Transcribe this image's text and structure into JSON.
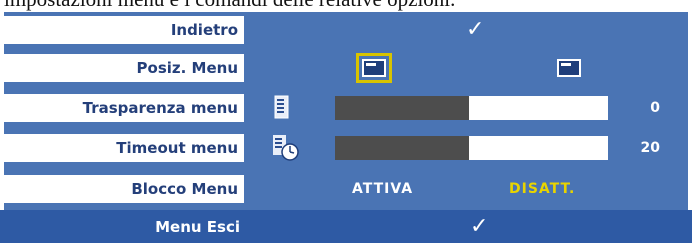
{
  "caption_fragment": "impostazioni menu e i comandi delle relative opzioni.",
  "menu": {
    "back": {
      "label": "Indietro"
    },
    "menu_position": {
      "label": "Posiz. Menu"
    },
    "menu_transparency": {
      "label": "Trasparenza menu",
      "value": "0",
      "level": 0.49
    },
    "menu_timeout": {
      "label": "Timeout menu",
      "value": "20",
      "level": 0.49
    },
    "menu_lock": {
      "label": "Blocco Menu",
      "option_on": "ATTIVA",
      "option_off": "DISATT.",
      "selected": "DISATT."
    },
    "exit": {
      "label": "Menu Esci"
    }
  },
  "check_glyph": "✓",
  "colors": {
    "panel_bg": "#4a74b4",
    "label_text": "#243f7a",
    "exit_bar": "#2e5aa4",
    "selected_option": "#e8d400",
    "selected_outline": "#d8c400",
    "slider_fill": "#4d4d4d"
  },
  "icons": [
    "checkmark-icon",
    "menu-position-left-icon",
    "menu-position-right-icon",
    "transparency-icon",
    "timeout-clock-icon"
  ]
}
